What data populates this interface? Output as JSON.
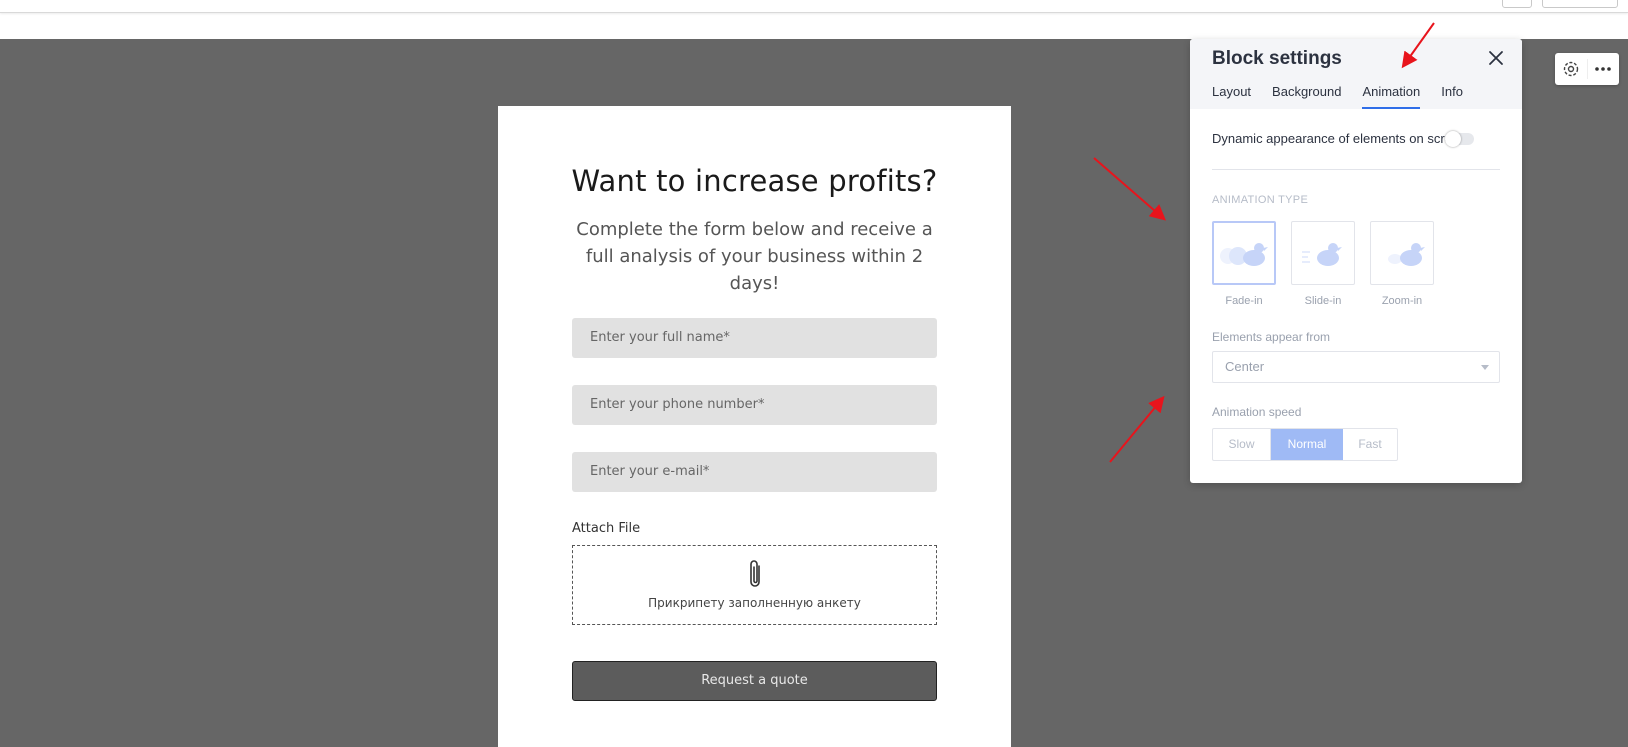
{
  "form": {
    "title": "Want to increase profits?",
    "subtitle": "Complete the form below and receive a full analysis of your business within 2 days!",
    "fields": [
      {
        "placeholder": "Enter your full name*"
      },
      {
        "placeholder": "Enter your phone number*"
      },
      {
        "placeholder": "Enter your e-mail*"
      }
    ],
    "attach_label": "Attach File",
    "attach_text": "Прикрипету заполненную анкету",
    "submit_label": "Request a quote"
  },
  "panel": {
    "title": "Block settings",
    "tabs": [
      {
        "label": "Layout"
      },
      {
        "label": "Background"
      },
      {
        "label": "Animation",
        "active": true
      },
      {
        "label": "Info"
      }
    ],
    "toggle_label": "Dynamic appearance of elements on scroll",
    "toggle_on": false,
    "animation_type_label": "ANIMATION TYPE",
    "animation_types": [
      {
        "label": "Fade-in",
        "selected": true
      },
      {
        "label": "Slide-in",
        "selected": false
      },
      {
        "label": "Zoom-in",
        "selected": false
      }
    ],
    "appear_from_label": "Elements appear from",
    "appear_from_value": "Center",
    "speed_label": "Animation speed",
    "speeds": [
      {
        "label": "Slow",
        "active": false
      },
      {
        "label": "Normal",
        "active": true
      },
      {
        "label": "Fast",
        "active": false
      }
    ]
  },
  "colors": {
    "canvas_bg": "#666666",
    "accent": "#2f6ee8",
    "selected_speed": "#9fbaf5",
    "annotation_arrow": "#e8141c"
  },
  "icons": {
    "close": "close-icon",
    "gear": "gear-icon",
    "more": "more-dots-icon",
    "paperclip": "paperclip-icon"
  }
}
